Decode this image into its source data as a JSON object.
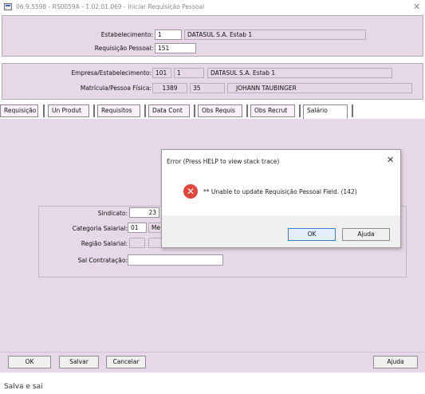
{
  "window": {
    "title": "06.9.5598 - RS0059A - 1.02.01.069 - Iniciar Requisição Pessoal",
    "close": "✕"
  },
  "header": {
    "estabelecimento_label": "Estabelecimento:",
    "estabelecimento_code": "1",
    "estabelecimento_name": "DATASUL S.A. Estab 1",
    "requisicao_label": "Requisição Pessoal:",
    "requisicao_value": "151"
  },
  "info": {
    "empresa_label": "Empresa/Estabelecimento:",
    "empresa_code": "101",
    "estab_code": "1",
    "empresa_name": "DATASUL S.A. Estab 1",
    "matricula_label": "Matrícula/Pessoa Física:",
    "matricula_value": "1389",
    "pessoa_value": "35",
    "pessoa_name": "JOHANN TAUBINGER"
  },
  "tabs": [
    {
      "label": "Requisição"
    },
    {
      "label": "Un Produt"
    },
    {
      "label": "Requisitos"
    },
    {
      "label": "Data Cont"
    },
    {
      "label": "Obs Requis"
    },
    {
      "label": "Obs Recrut"
    },
    {
      "label": "Salário"
    }
  ],
  "salario": {
    "sindicato_label": "Sindicato:",
    "sindicato_value": "23",
    "categoria_label": "Categoria Salarial:",
    "categoria_value": "01",
    "categoria_desc": "Me",
    "regiao_label": "Região Salarial:",
    "sal_label": "Sal Contratação:",
    "sal_value": ""
  },
  "dialog": {
    "title": "Error (Press HELP to view stack trace)",
    "close": "✕",
    "icon": "error-icon",
    "message": "** Unable to update Requisição Pessoal Field. (142)",
    "ok_label": "OK",
    "ajuda_label": "Ajuda"
  },
  "buttons": {
    "ok": "OK",
    "salvar": "Salvar",
    "cancelar": "Cancelar",
    "ajuda": "Ajuda"
  },
  "status": {
    "text": "Salva e sai"
  },
  "colors": {
    "panel": "#e6d8e7",
    "error": "#e0463b"
  }
}
